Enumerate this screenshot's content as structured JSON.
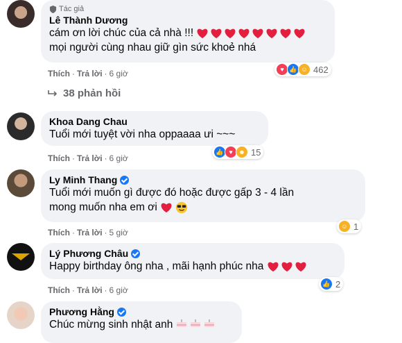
{
  "comments": [
    {
      "author_tag": "Tác giả",
      "name": "Lê Thành Dương",
      "line1": "cám ơn lời chúc của cả nhà !!!",
      "line2": "mọi người cùng nhau giữ gìn sức khoẻ nhá",
      "heart_count": 8,
      "like": "Thích",
      "reply": "Trả lời",
      "time": "6 giờ",
      "reaction_count": "462",
      "reaction_icons": [
        "love-icon",
        "like-icon",
        "care-icon"
      ]
    },
    {
      "name": "Khoa Dang Chau",
      "line1": "Tuổi mới tuyệt vời nha oppaaaa ưi ~~~",
      "like": "Thích",
      "reply": "Trả lời",
      "time": "6 giờ",
      "reaction_count": "15",
      "reaction_icons": [
        "like-icon",
        "love-icon",
        "haha-icon"
      ]
    },
    {
      "name": "Ly Minh Thang",
      "verified": true,
      "line1": "Tuổi mới muốn gì được đó hoặc được gấp 3 - 4 lần",
      "line2": "mong muốn nha em ơi",
      "like": "Thích",
      "reply": "Trả lời",
      "time": "5 giờ",
      "reaction_count": "1",
      "reaction_icons": [
        "care-icon"
      ]
    },
    {
      "name": "Lý Phương Châu",
      "verified": true,
      "line1": "Happy birthday ông nha , mãi hạnh phúc nha",
      "heart_count": 3,
      "like": "Thích",
      "reply": "Trả lời",
      "time": "6 giờ",
      "reaction_count": "2",
      "reaction_icons": [
        "like-icon"
      ]
    },
    {
      "name": "Phương Hằng",
      "verified": true,
      "line1": "Chúc mừng sinh nhật anh"
    }
  ],
  "replies_label": "38 phản hồi",
  "colors": {
    "bubble": "#f0f2f5",
    "meta_text": "#65676b",
    "like_blue": "#1877f2",
    "love_red": "#f33e58",
    "heart": "#e41e3f"
  }
}
